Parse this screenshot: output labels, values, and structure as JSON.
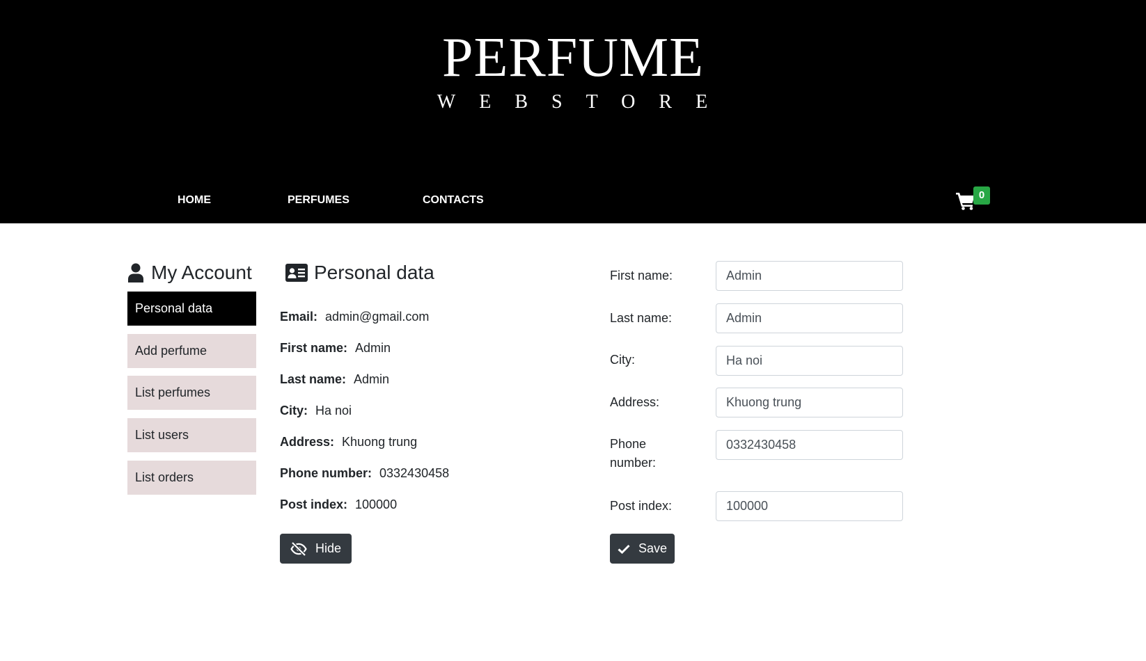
{
  "logo": {
    "main": "PERFUME",
    "sub": "WEBSTORE"
  },
  "nav": {
    "items": [
      "HOME",
      "PERFUMES",
      "CONTACTS"
    ]
  },
  "cart": {
    "count": "0",
    "icon": "shopping-cart-icon",
    "badge_color": "#28a745"
  },
  "sidebar": {
    "title": "My Account",
    "items": [
      "Personal data",
      "Add perfume",
      "List perfumes",
      "List users",
      "List orders"
    ],
    "active_index": 0
  },
  "personal_data": {
    "title": "Personal data",
    "rows": [
      {
        "label": "Email:",
        "value": "admin@gmail.com"
      },
      {
        "label": "First name:",
        "value": "Admin"
      },
      {
        "label": "Last name:",
        "value": "Admin"
      },
      {
        "label": "City:",
        "value": "Ha noi"
      },
      {
        "label": "Address:",
        "value": "Khuong trung"
      },
      {
        "label": "Phone number:",
        "value": "0332430458"
      },
      {
        "label": "Post index:",
        "value": "100000"
      }
    ],
    "hide_label": "Hide"
  },
  "form": {
    "fields": [
      {
        "label": "First name:",
        "value": "Admin"
      },
      {
        "label": "Last name:",
        "value": "Admin"
      },
      {
        "label": "City:",
        "value": "Ha noi"
      },
      {
        "label": "Address:",
        "value": "Khuong trung"
      },
      {
        "label": "Phone number:",
        "value": "0332430458"
      },
      {
        "label": "Post index:",
        "value": "100000"
      }
    ],
    "save_label": "Save"
  },
  "colors": {
    "header_bg": "#000000",
    "sidebar_item_bg": "#e6dadb",
    "button_bg": "#343a40"
  }
}
